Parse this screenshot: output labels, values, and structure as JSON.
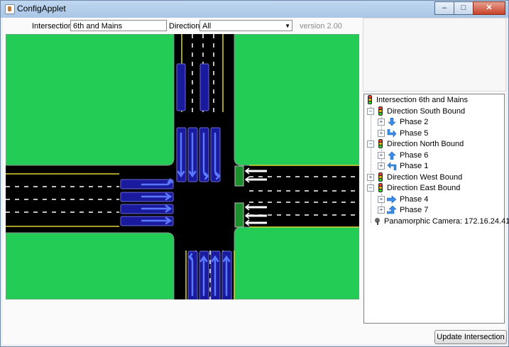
{
  "window": {
    "title": "ConfigApplet",
    "controls": {
      "minimize": "–",
      "maximize": "□",
      "close": "✕"
    }
  },
  "toolbar": {
    "intersection_label": "Intersection:",
    "intersection_value": "6th and Mains",
    "direction_label": "Direction:",
    "direction_value": "All",
    "version": "version 2.00"
  },
  "tree": {
    "root": "Intersection 6th and Mains",
    "directions": [
      {
        "label": "Direction South Bound",
        "expanded": true,
        "phases": [
          {
            "label": "Phase 2",
            "icon": "arrow-down-icon"
          },
          {
            "label": "Phase 5",
            "icon": "arrow-turn-right-icon"
          }
        ]
      },
      {
        "label": "Direction North Bound",
        "expanded": true,
        "phases": [
          {
            "label": "Phase 6",
            "icon": "arrow-up-icon"
          },
          {
            "label": "Phase 1",
            "icon": "arrow-turn-left-icon"
          }
        ]
      },
      {
        "label": "Direction West Bound",
        "expanded": false,
        "phases": []
      },
      {
        "label": "Direction East Bound",
        "expanded": true,
        "phases": [
          {
            "label": "Phase 4",
            "icon": "arrow-right-icon"
          },
          {
            "label": "Phase 7",
            "icon": "arrow-turn-up-icon"
          }
        ]
      }
    ],
    "camera": "Panamorphic Camera: 172.16.24.41"
  },
  "buttons": {
    "update": "Update Intersection"
  },
  "colors": {
    "grass": "#22cc55",
    "road": "#000000",
    "lane_box": "#1a1a9e",
    "arrow": "#5b79ff",
    "curb": "#e0d23a"
  }
}
